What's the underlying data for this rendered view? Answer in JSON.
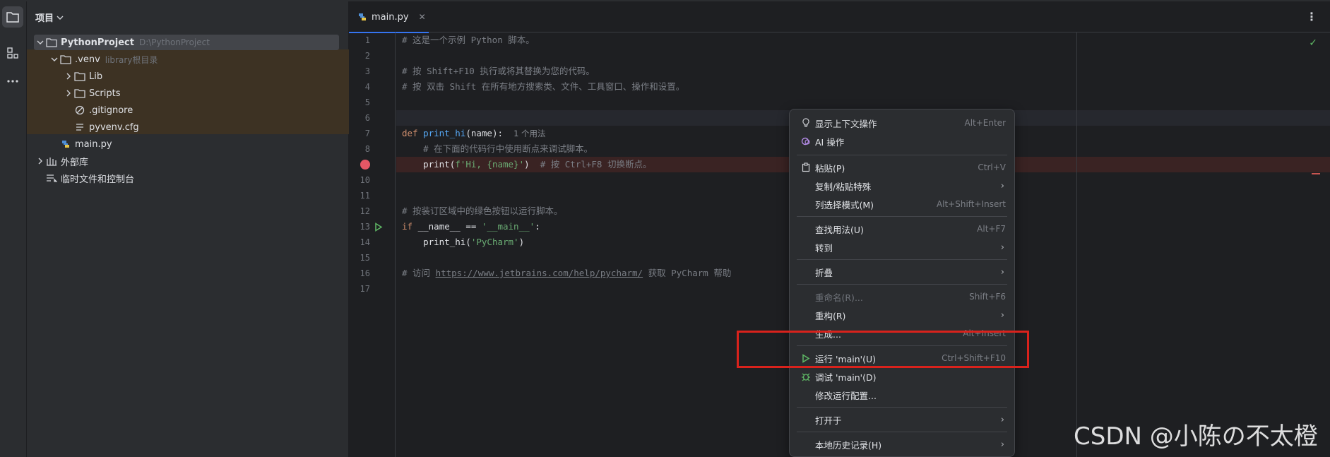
{
  "project_panel": {
    "title": "项目",
    "tree": [
      {
        "label": "PythonProject",
        "hint": "D:\\PythonProject"
      },
      {
        "label": ".venv",
        "hint": "library根目录"
      },
      {
        "label": "Lib"
      },
      {
        "label": "Scripts"
      },
      {
        "label": ".gitignore"
      },
      {
        "label": "pyvenv.cfg"
      },
      {
        "label": "main.py"
      },
      {
        "label": "外部库"
      },
      {
        "label": "临时文件和控制台"
      }
    ]
  },
  "editor": {
    "tab_label": "main.py",
    "line_numbers": [
      "1",
      "2",
      "3",
      "4",
      "5",
      "6",
      "7",
      "8",
      "9",
      "10",
      "11",
      "12",
      "13",
      "14",
      "15",
      "16",
      "17"
    ],
    "code": {
      "l1": "# 这是一个示例 Python 脚本。",
      "l3": "# 按 Shift+F10 执行或将其替换为您的代码。",
      "l4": "# 按 双击 Shift 在所有地方搜索类、文件、工具窗口、操作和设置。",
      "l7_def": "def",
      "l7_fn": "print_hi",
      "l7_args": "(name):",
      "l7_inlay": "1 个用法",
      "l8": "    # 在下面的代码行中使用断点来调试脚本。",
      "l9_call": "    print(",
      "l9_str": "f'Hi, {name}'",
      "l9_close": ")",
      "l9_comment": "  # 按 Ctrl+F8 切换断点。",
      "l12": "# 按装订区域中的绿色按钮以运行脚本。",
      "l13_if": "if",
      "l13_mid": " __name__ == ",
      "l13_str": "'__main__'",
      "l13_colon": ":",
      "l14_call": "    print_hi(",
      "l14_str": "'PyCharm'",
      "l14_close": ")",
      "l16_pre": "# 访问 ",
      "l16_link": "https://www.jetbrains.com/help/pycharm/",
      "l16_post": " 获取 PyCharm 帮助"
    }
  },
  "context_menu": {
    "items": [
      {
        "label": "显示上下文操作",
        "shortcut": "Alt+Enter"
      },
      {
        "label": "AI 操作",
        "shortcut": ""
      },
      {
        "label": "粘贴(P)",
        "shortcut": "Ctrl+V"
      },
      {
        "label": "复制/粘贴特殊",
        "shortcut": ""
      },
      {
        "label": "列选择模式(M)",
        "shortcut": "Alt+Shift+Insert"
      },
      {
        "label": "查找用法(U)",
        "shortcut": "Alt+F7"
      },
      {
        "label": "转到",
        "shortcut": ""
      },
      {
        "label": "折叠",
        "shortcut": ""
      },
      {
        "label": "重命名(R)...",
        "shortcut": "Shift+F6"
      },
      {
        "label": "重构(R)",
        "shortcut": ""
      },
      {
        "label": "生成...",
        "shortcut": "Alt+Insert"
      },
      {
        "label": "运行 'main'(U)",
        "shortcut": "Ctrl+Shift+F10"
      },
      {
        "label": "调试 'main'(D)",
        "shortcut": ""
      },
      {
        "label": "修改运行配置...",
        "shortcut": ""
      },
      {
        "label": "打开于",
        "shortcut": ""
      },
      {
        "label": "本地历史记录(H)",
        "shortcut": ""
      }
    ]
  },
  "watermark": "CSDN @小陈の不太橙",
  "colors": {
    "accent": "#3574f0",
    "breakpoint": "#e55765",
    "run_green": "#5fb865",
    "highlight_box": "#d9221c"
  }
}
